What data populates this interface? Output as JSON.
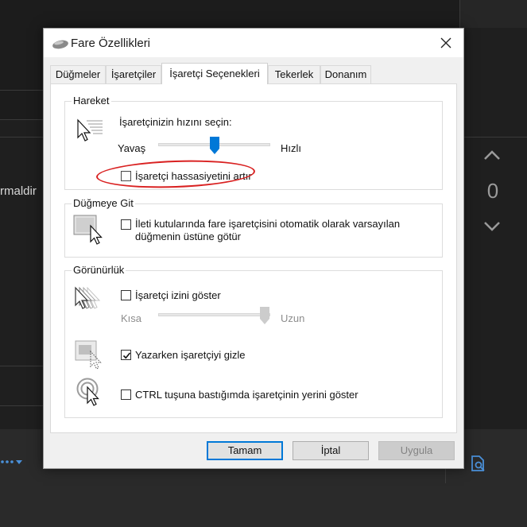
{
  "background": {
    "truncated_text": "rmaldir",
    "vote_count": "0"
  },
  "dialog": {
    "title": "Fare Özellikleri",
    "tabs": [
      {
        "label": "Düğmeler"
      },
      {
        "label": "İşaretçiler"
      },
      {
        "label": "İşaretçi Seçenekleri"
      },
      {
        "label": "Tekerlek"
      },
      {
        "label": "Donanım"
      }
    ],
    "active_tab": "İşaretçi Seçenekleri",
    "motion": {
      "title": "Hareket",
      "speed_prompt": "İşaretçinizin hızını seçin:",
      "slow_label": "Yavaş",
      "fast_label": "Hızlı",
      "speed_level": 0.5,
      "enhance_precision_label": "İşaretçi hassasiyetini artır",
      "enhance_precision_checked": false
    },
    "snap_to": {
      "title": "Düğmeye Git",
      "label_line1": "İleti kutularında fare işaretçisini otomatik olarak varsayılan",
      "label_line2": "düğmenin üstüne götür",
      "checked": false
    },
    "visibility": {
      "title": "Görünürlük",
      "trails_label": "İşaretçi izini göster",
      "trails_checked": false,
      "short_label": "Kısa",
      "long_label": "Uzun",
      "trail_level": 1.0,
      "hide_typing_label": "Yazarken işaretçiyi gizle",
      "hide_typing_checked": true,
      "ctrl_label": "CTRL tuşuna bastığımda işaretçinin yerini göster",
      "ctrl_checked": false
    },
    "buttons": {
      "ok": "Tamam",
      "cancel": "İptal",
      "apply": "Uygula"
    }
  },
  "colors": {
    "accent": "#0078d7",
    "annotation": "#d92121",
    "app_background": "#1f1f1f"
  }
}
